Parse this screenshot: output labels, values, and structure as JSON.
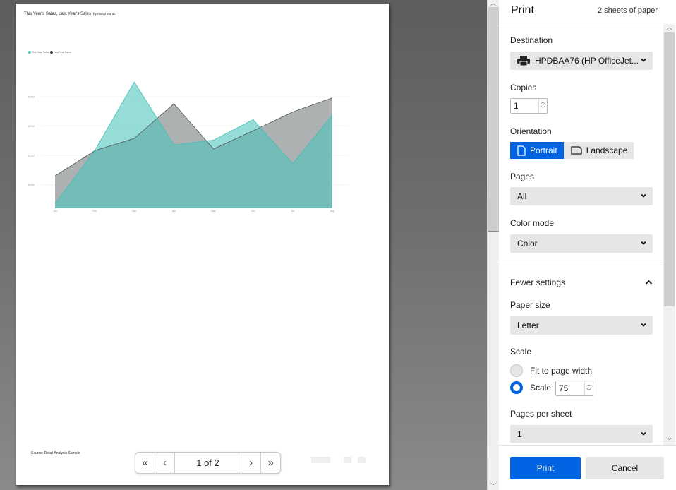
{
  "preview": {
    "chart_title": "This Year's Sales, Last Year's Sales",
    "chart_subtitle": "by Fiscal Month",
    "source_text": "Source: Retail Analysis Sample",
    "pager": {
      "first_label": "«",
      "prev_label": "‹",
      "page_indicator": "1 of 2",
      "next_label": "›",
      "last_label": "»"
    }
  },
  "chart_data": {
    "type": "area",
    "title": "This Year's Sales, Last Year's Sales",
    "subtitle": "by Fiscal Month",
    "categories": [
      "Jan",
      "Feb",
      "Mar",
      "Apr",
      "May",
      "Jun",
      "Jul",
      "Aug"
    ],
    "series": [
      {
        "name": "This Year Sales",
        "color": "#4ac5bb",
        "values": [
          6.8,
          15.8,
          27.5,
          16.8,
          17.6,
          21.1,
          13.6,
          21.9
        ]
      },
      {
        "name": "Last Year Sales",
        "color": "#6b6f70",
        "values": [
          11.5,
          15.8,
          17.9,
          23.8,
          16.1,
          19.2,
          22.4,
          24.8
        ]
      }
    ],
    "xlabel": "",
    "ylabel": "",
    "ylim": [
      6,
      28
    ],
    "yticks": [
      10,
      15,
      20,
      25
    ],
    "ytick_labels": [
      "$10M",
      "$15M",
      "$20M",
      "$25M"
    ],
    "grid": true,
    "legend_position": "top-left",
    "units": "$M"
  },
  "panel": {
    "title": "Print",
    "sheet_count": "2 sheets of paper",
    "destination": {
      "label": "Destination",
      "value": "HPDBAA76 (HP OfficeJet..."
    },
    "copies": {
      "label": "Copies",
      "value": "1"
    },
    "orientation": {
      "label": "Orientation",
      "options": [
        "Portrait",
        "Landscape"
      ],
      "selected": "Portrait"
    },
    "pages": {
      "label": "Pages",
      "value": "All"
    },
    "color_mode": {
      "label": "Color mode",
      "value": "Color"
    },
    "fewer_settings_label": "Fewer settings",
    "paper_size": {
      "label": "Paper size",
      "value": "Letter"
    },
    "scale": {
      "label": "Scale",
      "fit_option": "Fit to page width",
      "scale_option": "Scale",
      "selected": "Scale",
      "value": "75"
    },
    "pages_per_sheet": {
      "label": "Pages per sheet",
      "value": "1"
    },
    "print_button": "Print",
    "cancel_button": "Cancel"
  },
  "colors": {
    "accent": "#0063e1",
    "this_year": "#4ac5bb",
    "last_year": "#6b6f70"
  }
}
